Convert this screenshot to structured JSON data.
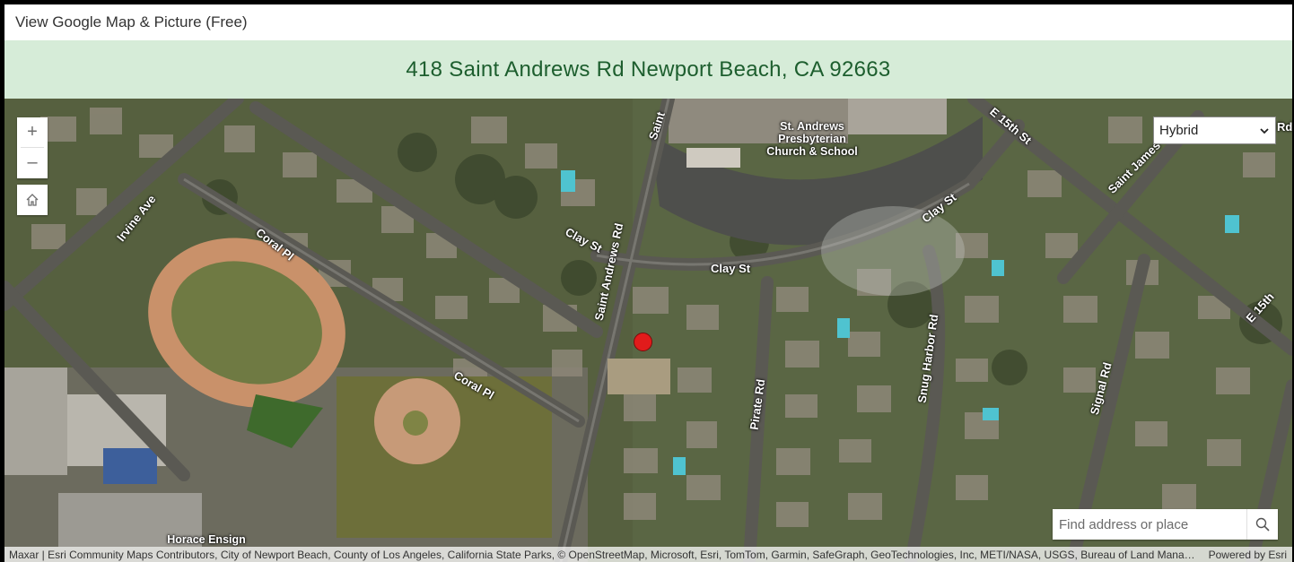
{
  "window": {
    "title": "View Google Map & Picture (Free)"
  },
  "address": {
    "text": "418 Saint Andrews Rd Newport Beach, CA 92663"
  },
  "map": {
    "zoom_in_label": "+",
    "zoom_out_label": "–",
    "layer_select": {
      "selected": "Hybrid"
    },
    "search": {
      "placeholder": "Find address or place",
      "value": ""
    },
    "street_labels": {
      "irvine_ave": "Irvine Ave",
      "coral_pl_upper": "Coral Pl",
      "coral_pl_lower": "Coral Pl",
      "saint_andrews_rd": "Saint Andrews Rd",
      "saint_andrews_rd_top": "Saint",
      "clay_st_left": "Clay St",
      "clay_st_middle": "Clay St",
      "clay_st_right": "Clay St",
      "pirate_rd": "Pirate Rd",
      "snug_harbor_rd": "Snug Harbor Rd",
      "signal_rd": "Signal Rd",
      "e_15th_st_top": "E 15th St",
      "e_15th_st_right": "E 15th",
      "saint_james": "Saint James",
      "rd_top_right": "Rd"
    },
    "poi_labels": {
      "church": "St. Andrews\nPresbyterian\nChurch & School",
      "school": "Horace Ensign"
    },
    "attribution": {
      "credits": "Maxar | Esri Community Maps Contributors, City of Newport Beach, County of Los Angeles, California State Parks, © OpenStreetMap, Microsoft, Esri, TomTom, Garmin, SafeGraph, GeoTechnologies, Inc, METI/NASA, USGS, Bureau of Land Management, EPA, NPS, US Census Bureau, USDA, USFWS",
      "powered_by": "Powered by Esri"
    }
  },
  "colors": {
    "banner_bg": "#d6ecd8",
    "banner_text": "#1d5e2e",
    "marker": "#e11b1b"
  }
}
